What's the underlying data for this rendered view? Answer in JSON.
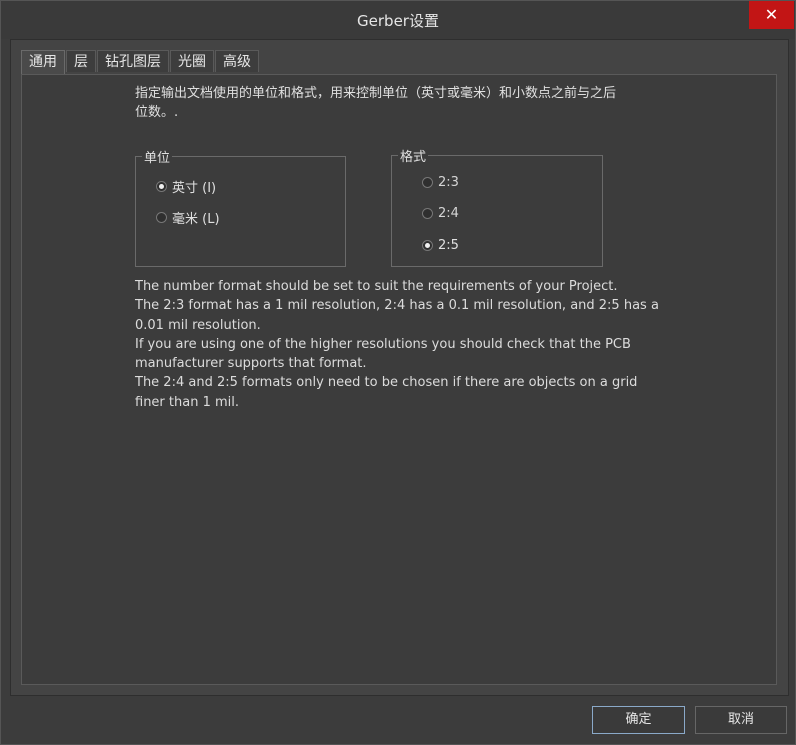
{
  "window": {
    "title": "Gerber设置",
    "close_label": "✕"
  },
  "tabs": [
    {
      "label": "通用",
      "active": true
    },
    {
      "label": "层",
      "active": false
    },
    {
      "label": "钻孔图层",
      "active": false
    },
    {
      "label": "光圈",
      "active": false
    },
    {
      "label": "高级",
      "active": false
    }
  ],
  "general": {
    "description_line1": "指定输出文档使用的单位和格式，用来控制单位（英寸或毫米）和小数点之前与之后",
    "description_line2": "位数。.",
    "units": {
      "label": "单位",
      "options": [
        {
          "label": "英寸 (I)",
          "checked": true
        },
        {
          "label": "毫米 (L)",
          "checked": false
        }
      ]
    },
    "format": {
      "label": "格式",
      "options": [
        {
          "label": "2:3",
          "checked": false
        },
        {
          "label": "2:4",
          "checked": false
        },
        {
          "label": "2:5",
          "checked": true
        }
      ]
    },
    "info_lines": [
      "The number format should be set to suit the requirements of your Project.",
      "The 2:3 format has a 1 mil resolution, 2:4 has a 0.1 mil resolution, and 2:5 has a",
      "0.01 mil resolution.",
      "If you are using one of the higher resolutions you should check that the PCB",
      "manufacturer supports that format.",
      "The 2:4 and 2:5 formats only need to be chosen if there are objects on a grid",
      "finer than 1 mil."
    ]
  },
  "footer": {
    "ok_label": "确定",
    "cancel_label": "取消"
  }
}
